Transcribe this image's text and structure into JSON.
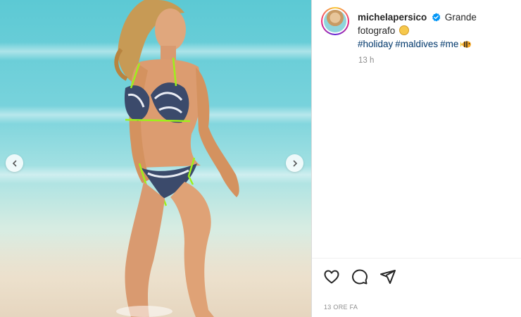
{
  "media": {
    "prev_icon": "chevron-left-icon",
    "next_icon": "chevron-right-icon"
  },
  "post": {
    "username": "michelapersico",
    "caption_text": "Grande fotografo",
    "hashtags": [
      "#holiday",
      "#maldives",
      "#me"
    ],
    "time_short": "13 h",
    "time_full": "13 ORE FA"
  },
  "actions": {
    "icons": [
      "heart-icon",
      "comment-icon",
      "share-icon"
    ]
  },
  "colors": {
    "username": "#262626",
    "hashtag": "#00376b",
    "muted": "#8e8e8e",
    "verified": "#0095f6"
  }
}
